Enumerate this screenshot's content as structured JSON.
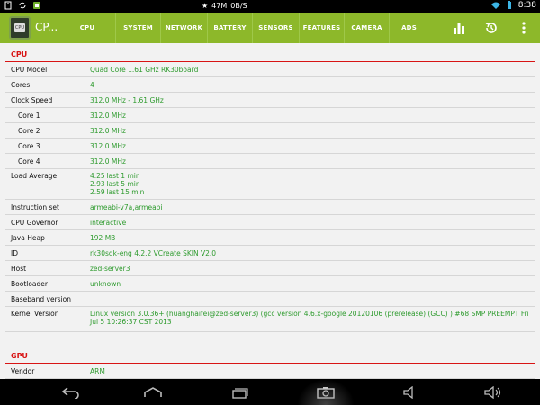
{
  "status_bar": {
    "network_speed": "47M",
    "throughput": "0B/S",
    "time": "8:38"
  },
  "action_bar": {
    "title": "CP...",
    "tabs": [
      "CPU",
      "SYSTEM",
      "NETWORK",
      "BATTERY",
      "SENSORS",
      "FEATURES",
      "CAMERA",
      "ADS"
    ],
    "icons": [
      "bar-chart-icon",
      "history-icon",
      "overflow-menu-icon"
    ]
  },
  "cpu": {
    "title": "CPU",
    "model_label": "CPU Model",
    "model": "Quad Core 1.61 GHz RK30board",
    "cores_label": "Cores",
    "cores": "4",
    "clock_label": "Clock Speed",
    "clock": "312.0 MHz - 1.61 GHz",
    "core_rows": [
      {
        "label": "Core 1",
        "value": "312.0 MHz"
      },
      {
        "label": "Core 2",
        "value": "312.0 MHz"
      },
      {
        "label": "Core 3",
        "value": "312.0 MHz"
      },
      {
        "label": "Core 4",
        "value": "312.0 MHz"
      }
    ],
    "load_label": "Load Average",
    "load": [
      {
        "num": "4.25",
        "period": "last 1 min"
      },
      {
        "num": "2.93",
        "period": "last 5 min"
      },
      {
        "num": "2.59",
        "period": "last 15 min"
      }
    ],
    "instruction_label": "Instruction set",
    "instruction": "armeabi-v7a,armeabi",
    "governor_label": "CPU Governor",
    "governor": "interactive",
    "heap_label": "Java Heap",
    "heap": "192 MB",
    "id_label": "ID",
    "id": "rk30sdk-eng 4.2.2 VCreate SKIN V2.0",
    "host_label": "Host",
    "host": "zed-server3",
    "bootloader_label": "Bootloader",
    "bootloader": "unknown",
    "baseband_label": "Baseband version",
    "baseband": "",
    "kernel_label": "Kernel Version",
    "kernel": "Linux version 3.0.36+ (huanghaifei@zed-server3) (gcc version 4.6.x-google 20120106 (prerelease) (GCC) ) #68 SMP PREEMPT Fri Jul 5 10:26:37 CST 2013"
  },
  "gpu": {
    "title": "GPU",
    "vendor_label": "Vendor",
    "vendor": "ARM"
  },
  "nav_bar": {
    "icons": [
      "back-icon",
      "home-icon",
      "recent-apps-icon",
      "screenshot-icon",
      "volume-down-icon",
      "volume-up-icon"
    ]
  },
  "colors": {
    "accent": "#8db82a",
    "section_title": "#d81414",
    "value_text": "#2e9b2e",
    "background": "#f2f2f2"
  }
}
